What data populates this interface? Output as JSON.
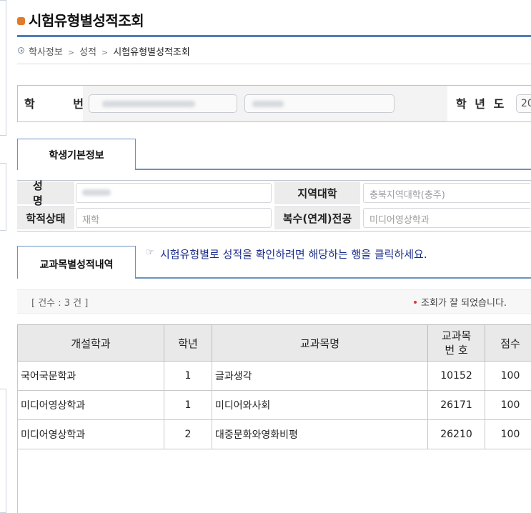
{
  "page": {
    "title": "시험유형별성적조회",
    "accent": "#4d7fb8",
    "bullet_color": "#e07b2b"
  },
  "breadcrumb": {
    "items": [
      "학사정보",
      "성적",
      "시험유형별성적조회"
    ],
    "separator": ">"
  },
  "search": {
    "hakbun_label": "학 번",
    "year_label": "학 년 도",
    "year_value": "20"
  },
  "tabs": {
    "basic_info": "학생기본정보",
    "course_grades": "교과목별성적내역"
  },
  "student": {
    "name_label": "성 명",
    "region_label": "지역대학",
    "region_value": "충북지역대학(충주)",
    "status_label": "학적상태",
    "status_value": "재학",
    "major_label": "복수(연계)전공",
    "major_value": "미디어영상학과"
  },
  "hint": {
    "icon": "pointing-hand-icon",
    "text": "시험유형별로 성적을 확인하려면 해당하는 행을 클릭하세요."
  },
  "summary": {
    "count_text": "[ 건수 : 3 건 ]",
    "status_text": "조회가 잘 되었습니다.",
    "status_color": "#d23b3b"
  },
  "grades": {
    "headers": {
      "dept": "개설학과",
      "year": "학년",
      "course": "교과목명",
      "code_line1": "교과목",
      "code_line2": "번 호",
      "score": "점수"
    },
    "rows": [
      {
        "dept": "국어국문학과",
        "year": "1",
        "course": "글과생각",
        "code": "10152",
        "score": "100"
      },
      {
        "dept": "미디어영상학과",
        "year": "1",
        "course": "미디어와사회",
        "code": "26171",
        "score": "100"
      },
      {
        "dept": "미디어영상학과",
        "year": "2",
        "course": "대중문화와영화비평",
        "code": "26210",
        "score": "100"
      }
    ]
  }
}
